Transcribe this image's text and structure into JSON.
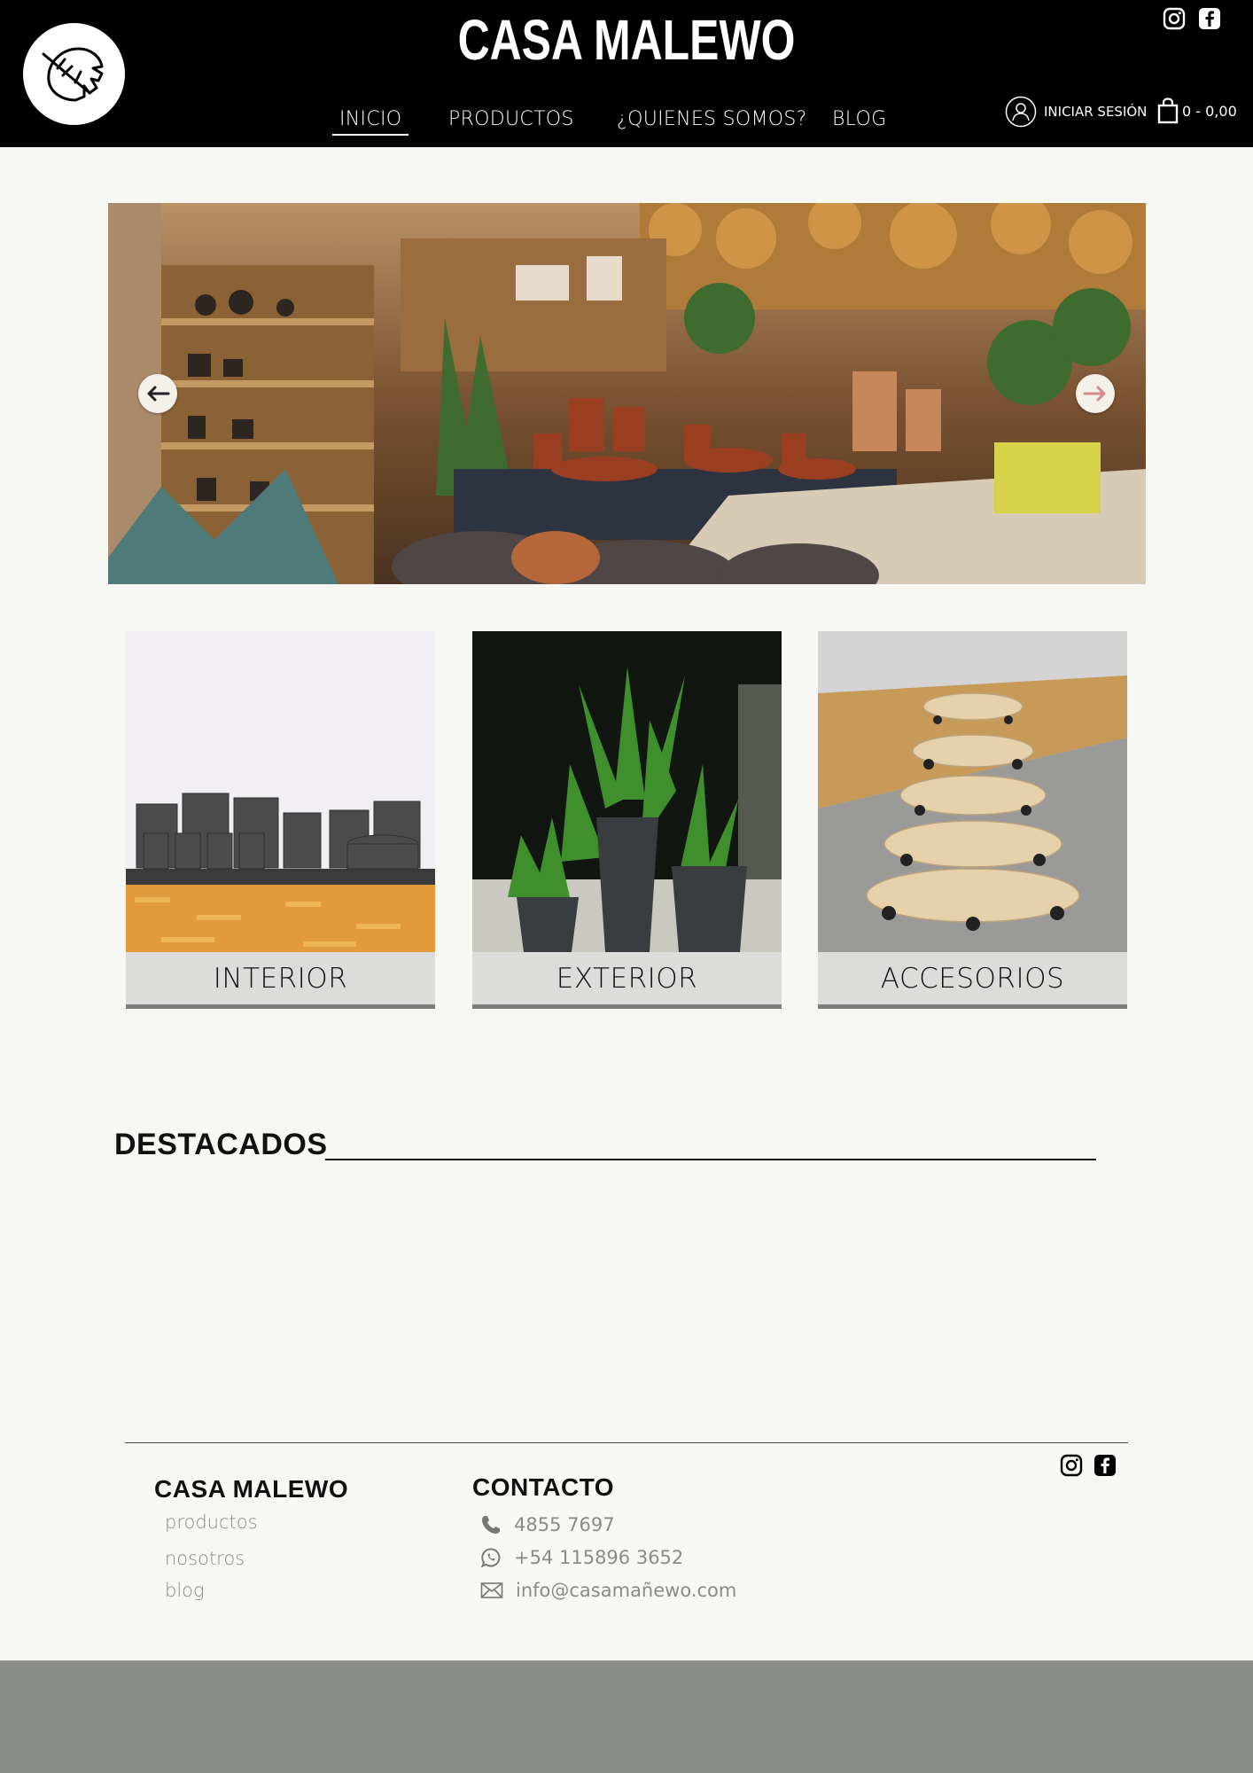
{
  "header": {
    "brand": "CASA MALEWO",
    "nav": [
      "INICIO",
      "PRODUCTOS",
      "¿QUIENES SOMOS?",
      "BLOG"
    ],
    "login_label": "INICIAR SESIÓN",
    "cart_label": "0 - 0,00",
    "social_icons": [
      "instagram-icon",
      "facebook-icon"
    ]
  },
  "hero": {
    "prev_icon": "arrow-left-icon",
    "next_icon": "arrow-right-icon"
  },
  "categories": [
    "INTERIOR",
    "EXTERIOR",
    "ACCESORIOS"
  ],
  "featured": {
    "title": "DESTACADOS"
  },
  "footer": {
    "brand_title": "CASA MALEWO",
    "links": [
      "productos",
      "nosotros",
      "blog"
    ],
    "contact_title": "CONTACTO",
    "phone": "4855 7697",
    "whatsapp": "+54 115896 3652",
    "email": "info@casamañewo.com"
  },
  "colors": {
    "header_bg": "#000000",
    "page_bg": "#f7f7f4",
    "category_label_bg": "#dcdcda",
    "footer_band": "#8b8d8a"
  }
}
